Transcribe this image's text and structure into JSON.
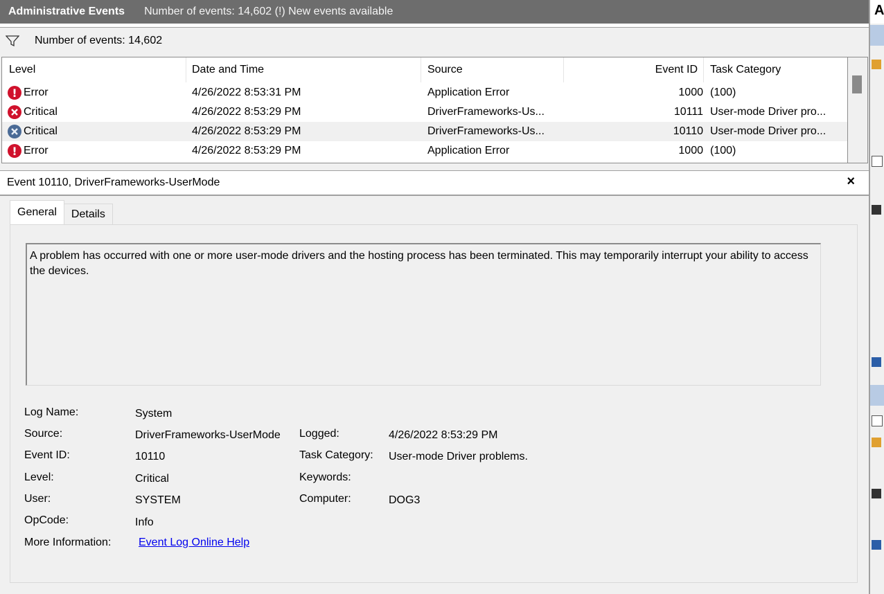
{
  "header": {
    "title": "Administrative Events",
    "status": "Number of events: 14,602 (!) New events available"
  },
  "filter": {
    "count_text": "Number of events: 14,602"
  },
  "table": {
    "columns": [
      "Level",
      "Date and Time",
      "Source",
      "Event ID",
      "Task Category"
    ],
    "rows": [
      {
        "level": "Error",
        "date": "4/26/2022 8:53:31 PM",
        "source": "Application Error",
        "event_id": "1000",
        "task": "(100)"
      },
      {
        "level": "Critical",
        "date": "4/26/2022 8:53:29 PM",
        "source": "DriverFrameworks-Us...",
        "event_id": "10111",
        "task": "User-mode Driver pro..."
      },
      {
        "level": "Critical",
        "date": "4/26/2022 8:53:29 PM",
        "source": "DriverFrameworks-Us...",
        "event_id": "10110",
        "task": "User-mode Driver pro..."
      },
      {
        "level": "Error",
        "date": "4/26/2022 8:53:29 PM",
        "source": "Application Error",
        "event_id": "1000",
        "task": "(100)"
      }
    ]
  },
  "detail": {
    "title": "Event 10110, DriverFrameworks-UserMode",
    "close": "×",
    "tabs": [
      "General",
      "Details"
    ],
    "description": "A problem has occurred with one or more user-mode drivers and the hosting process has been terminated.  This may temporarily interrupt your ability to access the devices.",
    "labels": {
      "log_name": "Log Name:",
      "source": "Source:",
      "event_id": "Event ID:",
      "level": "Level:",
      "user": "User:",
      "opcode": "OpCode:",
      "more_info": "More Information:",
      "logged": "Logged:",
      "task_category": "Task Category:",
      "keywords": "Keywords:",
      "computer": "Computer:"
    },
    "values": {
      "log_name": "System",
      "source": "DriverFrameworks-UserMode",
      "event_id": "10110",
      "level": "Critical",
      "user": "SYSTEM",
      "opcode": "Info",
      "more_info_link": "Event Log Online Help",
      "logged": "4/26/2022 8:53:29 PM",
      "task_category": "User-mode Driver problems.",
      "keywords": "",
      "computer": "DOG3"
    }
  },
  "right_panel": {
    "title_initial": "A"
  }
}
